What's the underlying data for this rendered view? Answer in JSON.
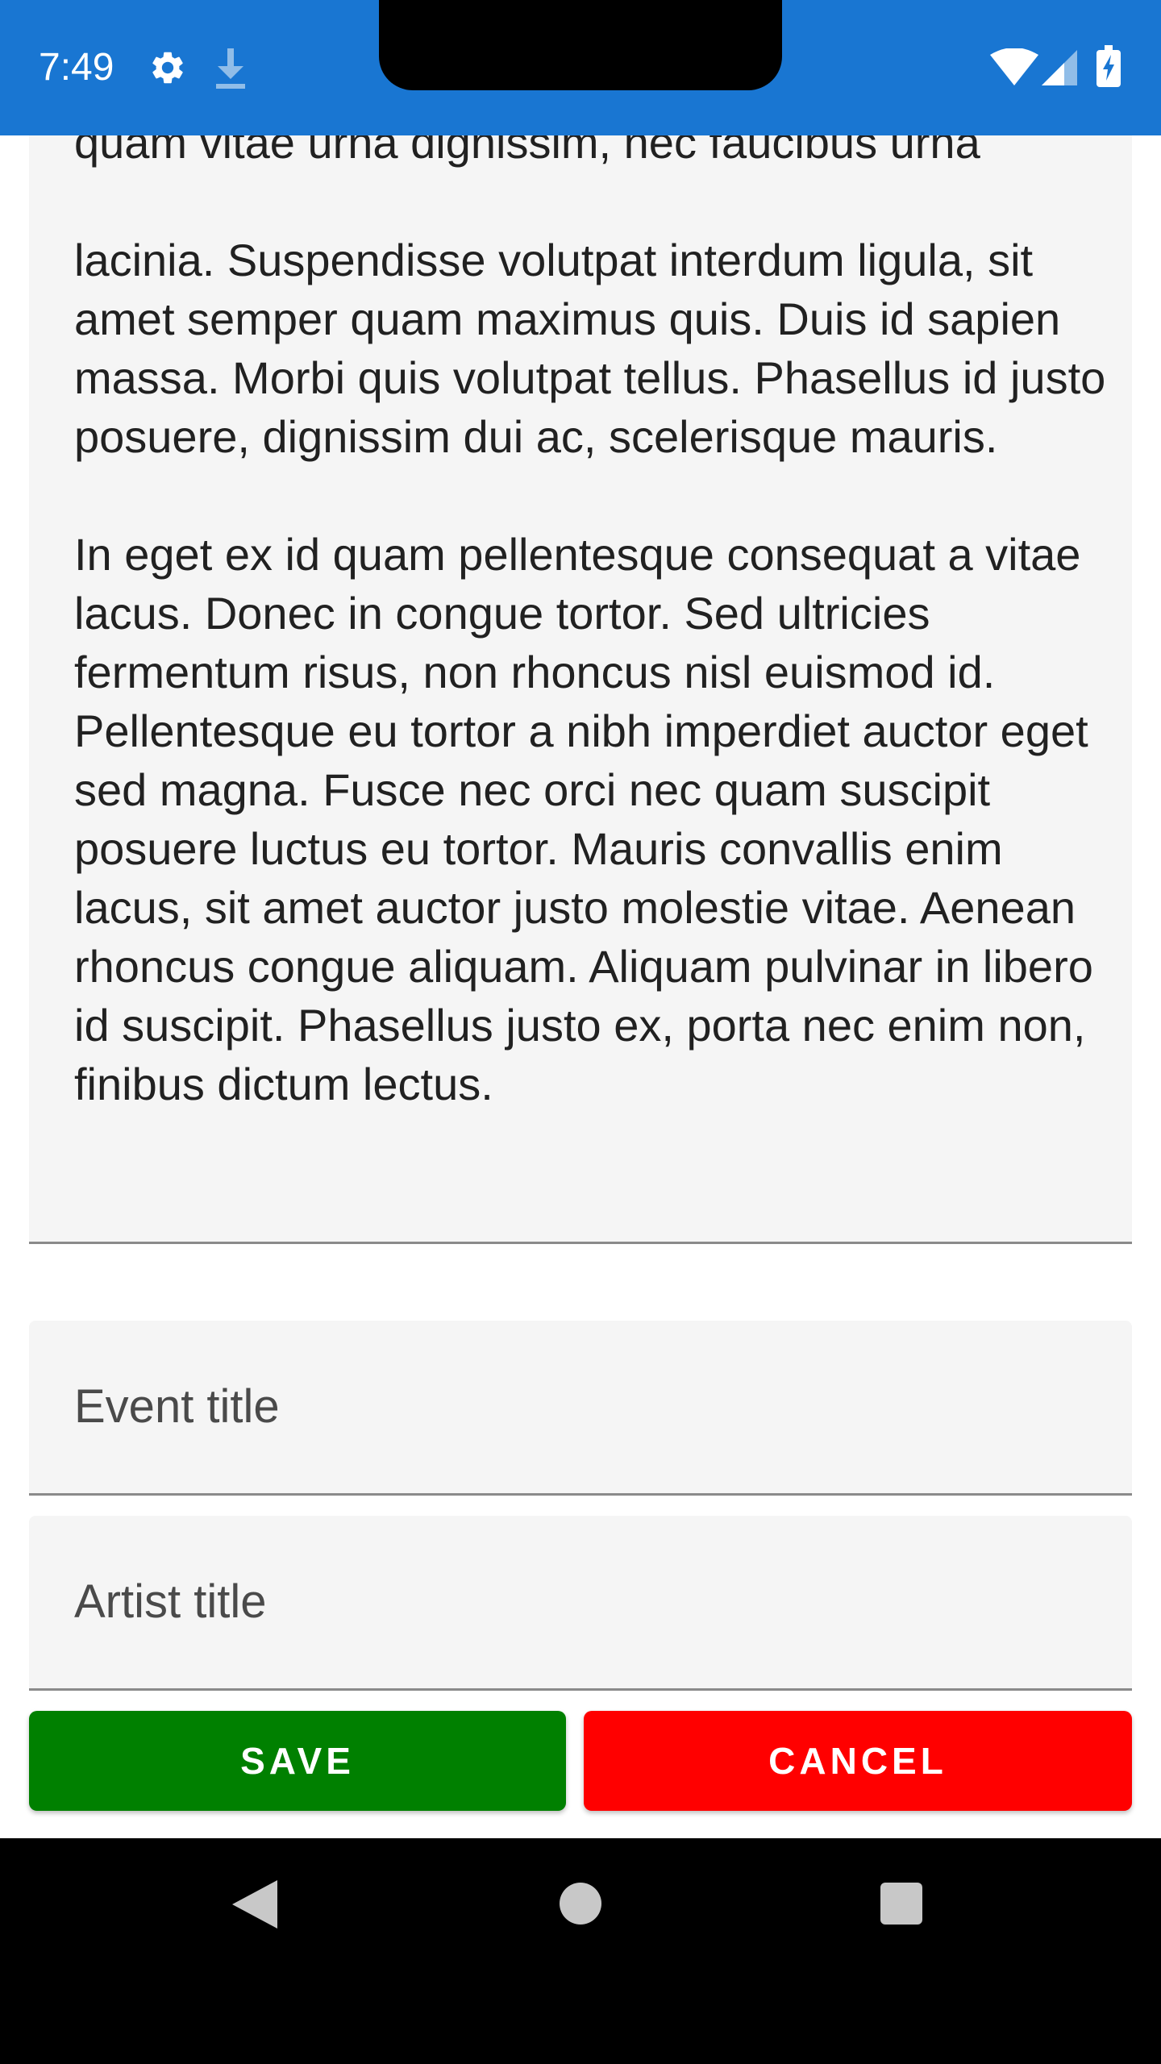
{
  "status_bar": {
    "time": "7:49",
    "icons": [
      "gear-icon",
      "download-icon",
      "wifi-icon",
      "signal-icon",
      "battery-charging-icon"
    ],
    "background": "#1976d2"
  },
  "notes": {
    "partial_line": "quam vitae urna dignissim, nec faucibus urna",
    "paragraph1": "lacinia. Suspendisse volutpat interdum ligula, sit amet semper quam maximus quis. Duis id sapien massa. Morbi quis volutpat tellus. Phasellus id justo posuere, dignissim dui ac, scelerisque mauris.",
    "paragraph2": "In eget ex id quam pellentesque consequat a vitae lacus. Donec in congue tortor. Sed ultricies fermentum risus, non rhoncus nisl euismod id. Pellentesque eu tortor a nibh imperdiet auctor eget sed magna. Fusce nec orci nec quam suscipit posuere luctus eu tortor. Mauris convallis enim lacus, sit amet auctor justo molestie vitae. Aenean rhoncus congue aliquam. Aliquam pulvinar in libero id suscipit. Phasellus justo ex, porta nec enim non, finibus dictum lectus."
  },
  "form": {
    "event_title_placeholder": "Event title",
    "artist_title_placeholder": "Artist title"
  },
  "buttons": {
    "save_label": "SAVE",
    "save_color": "#008000",
    "cancel_label": "CANCEL",
    "cancel_color": "#ff0000"
  },
  "nav_bar": {
    "icons": [
      "back-icon",
      "home-icon",
      "recents-icon"
    ]
  }
}
